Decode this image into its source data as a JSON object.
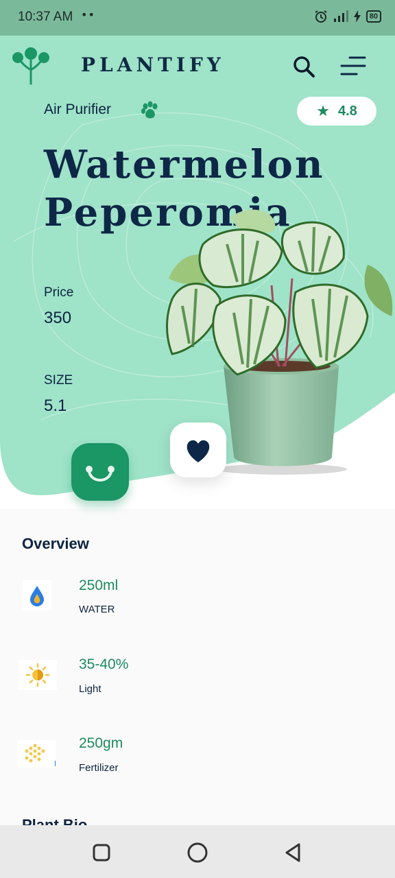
{
  "status_bar": {
    "time": "10:37 AM",
    "dots": "••",
    "battery": "80"
  },
  "header": {
    "brand": "PLANTIFY",
    "logo_icon": "tree-logo-icon",
    "search_icon": "search-icon",
    "menu_icon": "menu-icon"
  },
  "product": {
    "category": "Air Purifier",
    "category_icon": "paw-icon",
    "rating": "4.8",
    "rating_icon": "star-icon",
    "title_line1": "Watermelon",
    "title_line2": "Peperomia",
    "price_label": "Price",
    "price_value": "350",
    "size_label": "SIZE",
    "size_value": "5.1"
  },
  "actions": {
    "cart_icon": "smile-cart-icon",
    "favorite_icon": "heart-icon"
  },
  "overview": {
    "title": "Overview",
    "items": [
      {
        "value": "250ml",
        "label": "WATER",
        "icon": "water-drop-icon"
      },
      {
        "value": "35-40%",
        "label": "Light",
        "icon": "sun-icon"
      },
      {
        "value": "250gm",
        "label": "Fertilizer",
        "icon": "fertilizer-icon"
      }
    ]
  },
  "plant_bio_title": "Plant Bio",
  "colors": {
    "mint": "#9fe3c9",
    "brand_green": "#1b9665",
    "navy": "#0e2747",
    "status_bar": "#7bb99b"
  },
  "nav": {
    "recent_icon": "square-icon",
    "home_icon": "circle-icon",
    "back_icon": "triangle-back-icon"
  }
}
